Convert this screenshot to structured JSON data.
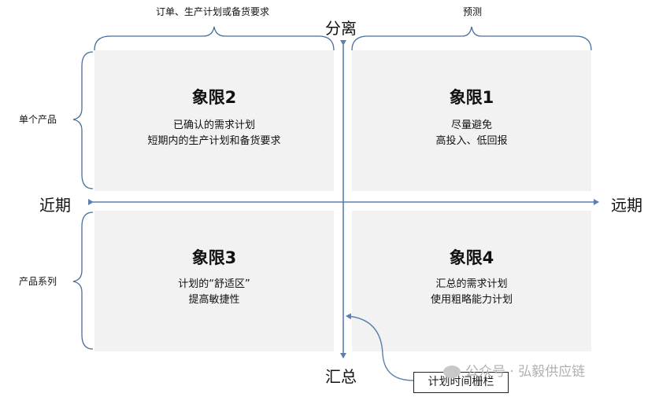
{
  "top_left_label": "订单、生产计划或备货要求",
  "top_right_label": "预测",
  "axis": {
    "top": "分离",
    "bottom": "汇总",
    "left": "近期",
    "right": "远期"
  },
  "side_labels": {
    "upper": "单个产品",
    "lower": "产品系列"
  },
  "quadrants": {
    "q1": {
      "title": "象限1",
      "lines": [
        "尽量避免",
        "高投入、低回报"
      ]
    },
    "q2": {
      "title": "象限2",
      "lines": [
        "已确认的需求计划",
        "短期内的生产计划和备货要求"
      ]
    },
    "q3": {
      "title": "象限3",
      "lines": [
        "计划的“舒适区”",
        "提高敏捷性"
      ]
    },
    "q4": {
      "title": "象限4",
      "lines": [
        "汇总的需求计划",
        "使用粗略能力计划"
      ]
    }
  },
  "callout": "计划时间栅栏",
  "watermark": "公众号 · 弘毅供应链",
  "colors": {
    "axis": "#5b7fb0",
    "quadrant_fill": "#f2f2f2",
    "brace": "#4a6e9c"
  }
}
